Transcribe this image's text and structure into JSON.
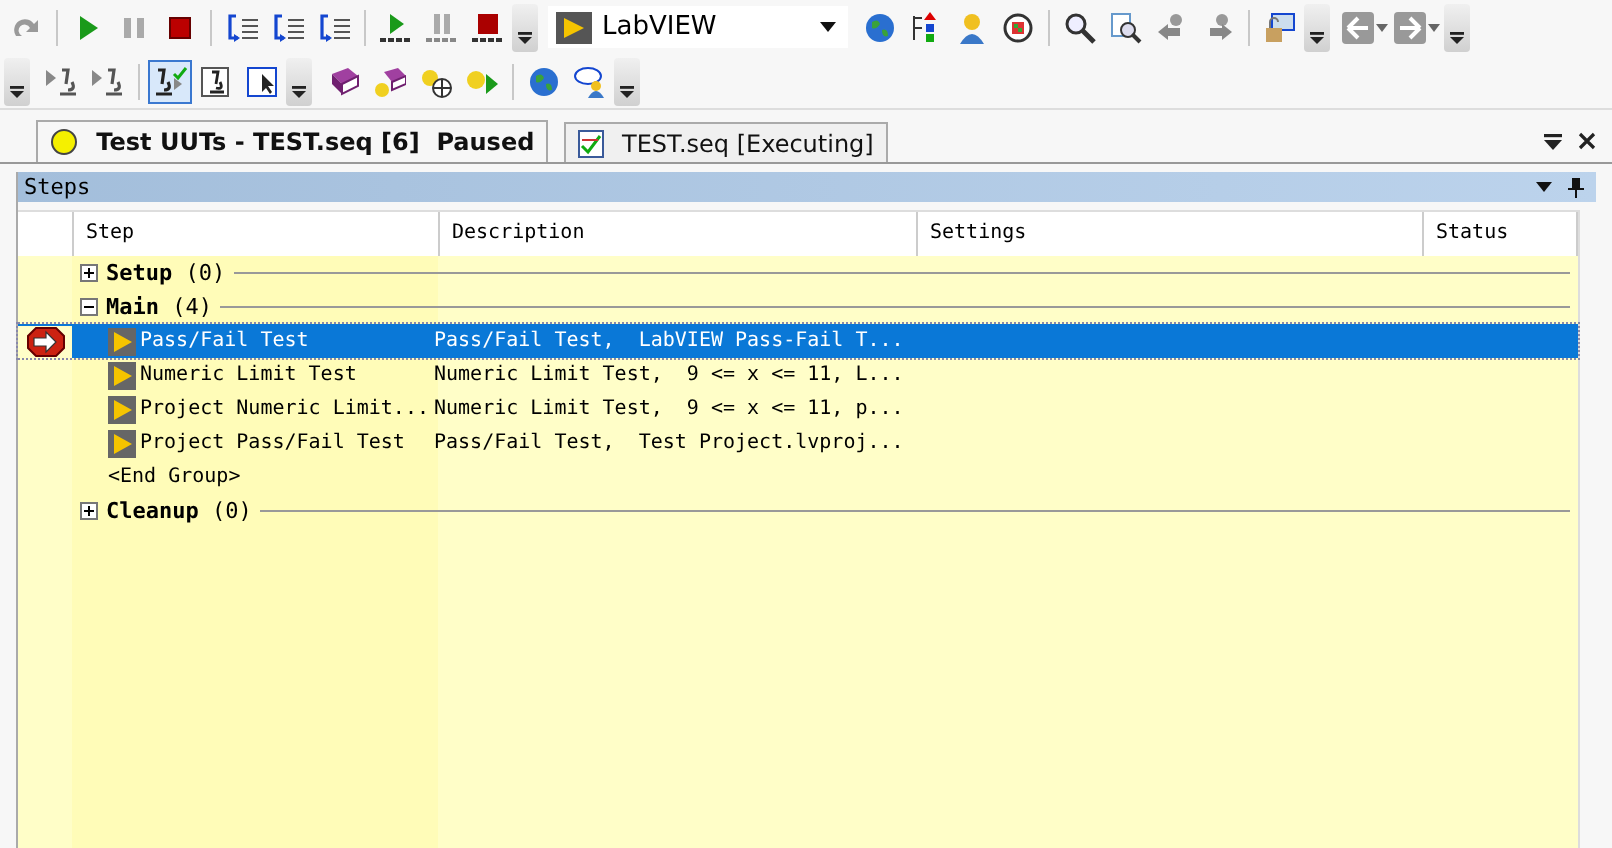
{
  "toolbar_top": [
    {
      "kind": "redo",
      "selected": false
    },
    {
      "kind": "sep"
    },
    {
      "kind": "run",
      "selected": false
    },
    {
      "kind": "pause",
      "selected": false
    },
    {
      "kind": "stop",
      "selected": false
    },
    {
      "kind": "sep"
    },
    {
      "kind": "step-into",
      "selected": false
    },
    {
      "kind": "step-over",
      "selected": false
    },
    {
      "kind": "step-out",
      "selected": false
    },
    {
      "kind": "sep"
    },
    {
      "kind": "run-all",
      "selected": false
    },
    {
      "kind": "pause-all",
      "selected": false
    },
    {
      "kind": "stop-all",
      "selected": false
    },
    {
      "kind": "grip"
    },
    {
      "kind": "combo"
    },
    {
      "kind": "globe",
      "selected": false
    },
    {
      "kind": "tree",
      "selected": false
    },
    {
      "kind": "user",
      "selected": false
    },
    {
      "kind": "cycle",
      "selected": false
    },
    {
      "kind": "sep"
    },
    {
      "kind": "search",
      "selected": false
    },
    {
      "kind": "find",
      "selected": false
    },
    {
      "kind": "back-user",
      "selected": false
    },
    {
      "kind": "fwd-user",
      "selected": false
    },
    {
      "kind": "sep"
    },
    {
      "kind": "lock",
      "selected": false
    },
    {
      "kind": "grip"
    },
    {
      "kind": "nav-back",
      "selected": false
    },
    {
      "kind": "nav-forward",
      "selected": false
    },
    {
      "kind": "grip"
    }
  ],
  "adapter": {
    "value": "LabVIEW"
  },
  "toolbar_bottom": [
    {
      "kind": "grip"
    },
    {
      "kind": "breakpoint",
      "selected": false
    },
    {
      "kind": "breakpoint-off",
      "selected": false
    },
    {
      "kind": "sep"
    },
    {
      "kind": "trace",
      "selected": true
    },
    {
      "kind": "watch",
      "selected": false
    },
    {
      "kind": "select",
      "selected": false
    },
    {
      "kind": "grip"
    },
    {
      "kind": "book",
      "selected": false
    },
    {
      "kind": "help-book",
      "selected": false
    },
    {
      "kind": "help-n",
      "selected": false
    },
    {
      "kind": "help-run",
      "selected": false
    },
    {
      "kind": "sep"
    },
    {
      "kind": "web",
      "selected": false
    },
    {
      "kind": "tooltip-user",
      "selected": false
    },
    {
      "kind": "grip"
    }
  ],
  "tabs": [
    {
      "label": "Test UUTs - TEST.seq [6]  Paused",
      "selected": true,
      "kind": "execution"
    },
    {
      "label": "TEST.seq [Executing]",
      "selected": false,
      "kind": "file"
    }
  ],
  "panel": {
    "title": "Steps"
  },
  "columns": [
    "Step",
    "Description",
    "Settings",
    "Status"
  ],
  "groups": [
    {
      "name": "Setup",
      "count": "(0)",
      "expanded": false
    },
    {
      "name": "Main",
      "count": "(4)",
      "expanded": true,
      "children": [
        {
          "step": "Pass/Fail Test",
          "description": "Pass/Fail Test,  LabVIEW Pass-Fail T...",
          "selected": true,
          "current": true
        },
        {
          "step": "Numeric Limit Test",
          "description": "Numeric Limit Test,  9 <= x <= 11, L...",
          "selected": false,
          "current": false
        },
        {
          "step": "Project Numeric Limit...",
          "description": "Numeric Limit Test,  9 <= x <= 11, p...",
          "selected": false,
          "current": false
        },
        {
          "step": "Project Pass/Fail Test",
          "description": "Pass/Fail Test,  Test Project.lvproj...",
          "selected": false,
          "current": false
        }
      ],
      "end": "<End Group>"
    },
    {
      "name": "Cleanup",
      "count": "(0)",
      "expanded": false
    }
  ]
}
